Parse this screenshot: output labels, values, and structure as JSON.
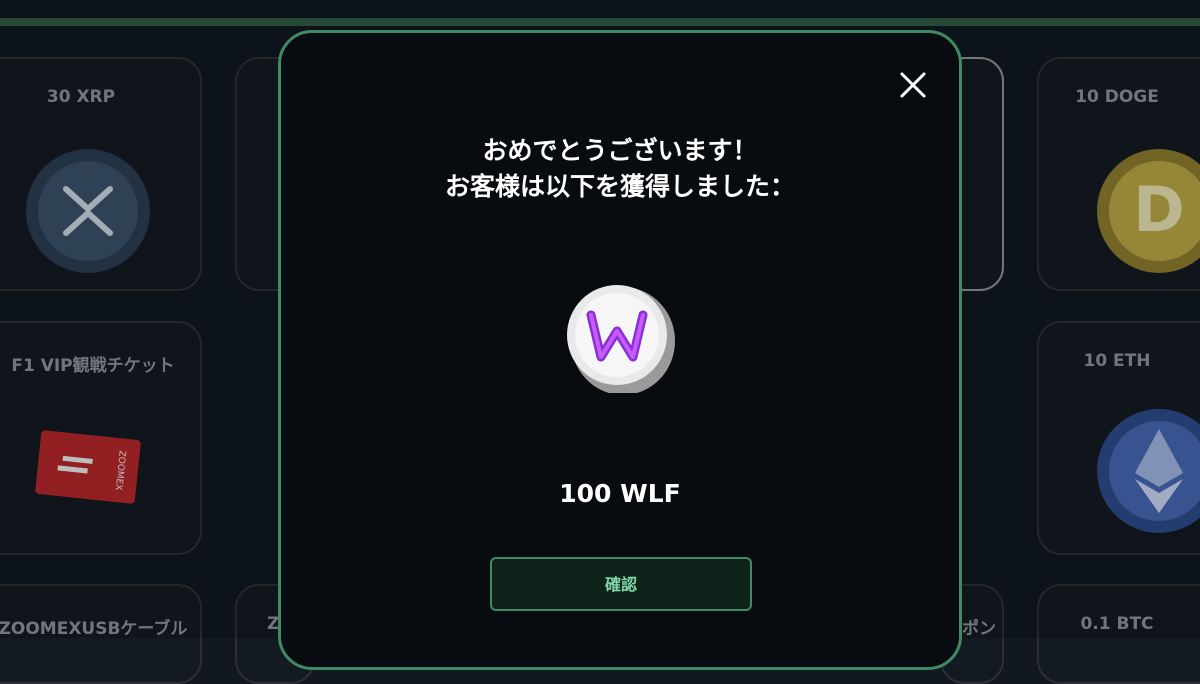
{
  "background_cards": [
    {
      "label": "30 XRP",
      "coin": "xrp-coin"
    },
    {
      "label": "10 DOGE",
      "coin": "doge-coin"
    },
    {
      "label": "F1 VIP観戦チケット",
      "coin": "f1-ticket"
    },
    {
      "label": "10 ETH",
      "coin": "eth-coin"
    },
    {
      "label": "ZOOMEXUSBケーブル",
      "coin": ""
    },
    {
      "label": "0.1 BTC",
      "coin": ""
    },
    {
      "label": "Z",
      "coin": ""
    },
    {
      "label": "ポン",
      "coin": ""
    }
  ],
  "ticket_text": "ZOOMEX",
  "modal": {
    "title_line1": "おめでとうございます！",
    "title_line2": "お客様は以下を獲得しました：",
    "prize_name": "100 WLF",
    "prize_icon": "wlf-coin-icon",
    "confirm_label": "確認",
    "close_icon": "close-icon"
  },
  "colors": {
    "accent": "#3f8a64",
    "confirm_text": "#7fd6a9",
    "modal_bg": "#080c10",
    "page_bg": "#111820"
  }
}
